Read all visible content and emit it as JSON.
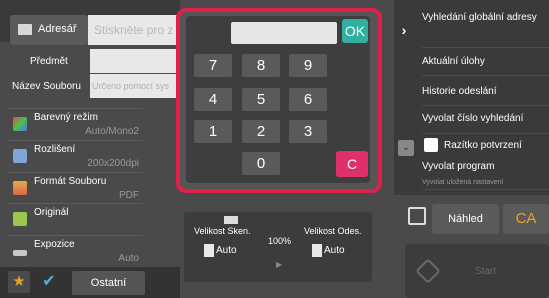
{
  "address": {
    "button_label": "Adresář",
    "input_placeholder": "Stiskněte pro z"
  },
  "fields": {
    "subject_label": "Předmět",
    "filename_label": "Název Souboru",
    "filename_placeholder": "Určeno pomocí sys"
  },
  "settings": [
    {
      "label": "Barevný režim",
      "value": "Auto/Mono2"
    },
    {
      "label": "Rozlišení",
      "value": "200x200dpi"
    },
    {
      "label": "Formát Souboru",
      "value": "PDF"
    },
    {
      "label": "Originál",
      "value": ""
    },
    {
      "label": "Expozice",
      "value": "Auto"
    }
  ],
  "bottom": {
    "others_label": "Ostatní"
  },
  "size_panel": {
    "scan_label": "Velikost Sken.",
    "scan_value": "Auto",
    "ratio": "100%",
    "send_label": "Velikost Odes.",
    "send_value": "Auto"
  },
  "right_menu": {
    "global_search": "Vyhledání globální adresy",
    "current_tasks": "Aktuální úlohy",
    "send_history": "Historie odeslání",
    "recall_number": "Vyvolat číslo vyhledání",
    "confirm_stamp": "Razítko potvrzení",
    "recall_program": "Vyvolat program",
    "recall_program_sub": "Vyvolat uložená nastavení"
  },
  "actions": {
    "preview_label": "Náhled",
    "ca_label": "CA",
    "start_label": "Start"
  },
  "keypad": {
    "ok_label": "OK",
    "clear_label": "C",
    "keys": [
      "7",
      "8",
      "9",
      "4",
      "5",
      "6",
      "1",
      "2",
      "3",
      "0"
    ],
    "display_value": ""
  },
  "colors": {
    "accent_ok": "#2fb0a0",
    "accent_clear": "#e0306a",
    "highlight_frame": "#e0204a",
    "ca_text": "#f0a020"
  },
  "icons": [
    "address-book-icon",
    "color-mode-icon",
    "resolution-icon",
    "file-format-icon",
    "original-icon",
    "exposure-icon",
    "star-icon",
    "check-icon",
    "chevron-right-icon",
    "chevron-down-icon",
    "preview-icon",
    "start-icon",
    "scanner-icon",
    "document-icon"
  ]
}
